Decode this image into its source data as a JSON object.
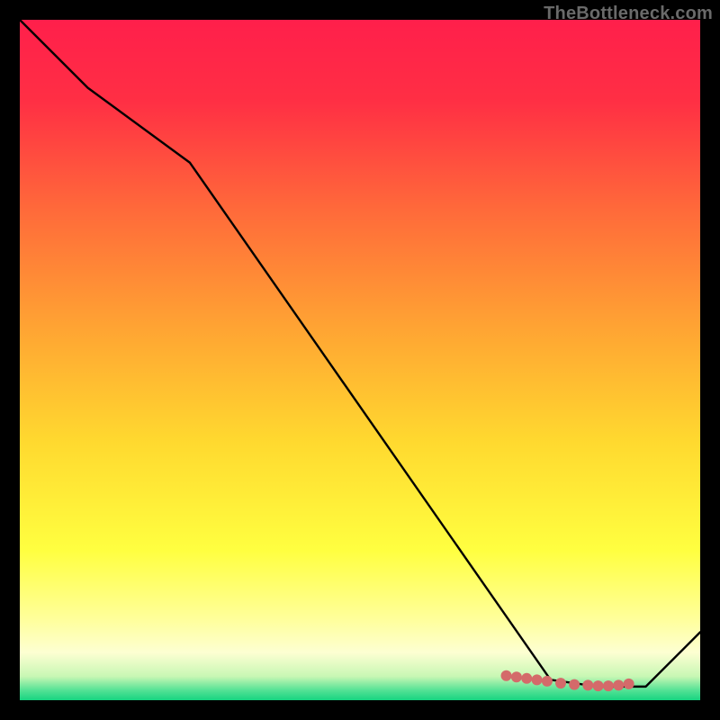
{
  "watermark": "TheBottleneck.com",
  "chart_data": {
    "type": "line",
    "title": "",
    "xlabel": "",
    "ylabel": "",
    "xlim": [
      0,
      100
    ],
    "ylim": [
      0,
      100
    ],
    "grid": false,
    "series": [
      {
        "name": "curve",
        "x": [
          0,
          10,
          25,
          78,
          85,
          92,
          100
        ],
        "y": [
          100,
          90,
          79,
          3,
          2,
          2,
          10
        ]
      }
    ],
    "markers": {
      "name": "floor-markers",
      "x": [
        71.5,
        73,
        74.5,
        76,
        77.5,
        79.5,
        81.5,
        83.5,
        85,
        86.5,
        88,
        89.5
      ],
      "y": [
        3.6,
        3.4,
        3.2,
        3.0,
        2.8,
        2.5,
        2.3,
        2.2,
        2.1,
        2.1,
        2.2,
        2.4
      ],
      "color": "#d46a6a",
      "radius": 6
    },
    "background_gradient": {
      "stops": [
        {
          "offset": 0.0,
          "color": "#ff1f4b"
        },
        {
          "offset": 0.12,
          "color": "#ff2f44"
        },
        {
          "offset": 0.28,
          "color": "#ff6a3a"
        },
        {
          "offset": 0.45,
          "color": "#ffa333"
        },
        {
          "offset": 0.62,
          "color": "#ffd92f"
        },
        {
          "offset": 0.78,
          "color": "#ffff40"
        },
        {
          "offset": 0.88,
          "color": "#ffff9a"
        },
        {
          "offset": 0.93,
          "color": "#fdffd2"
        },
        {
          "offset": 0.965,
          "color": "#c8f7b4"
        },
        {
          "offset": 0.985,
          "color": "#56e296"
        },
        {
          "offset": 1.0,
          "color": "#17d480"
        }
      ]
    }
  }
}
